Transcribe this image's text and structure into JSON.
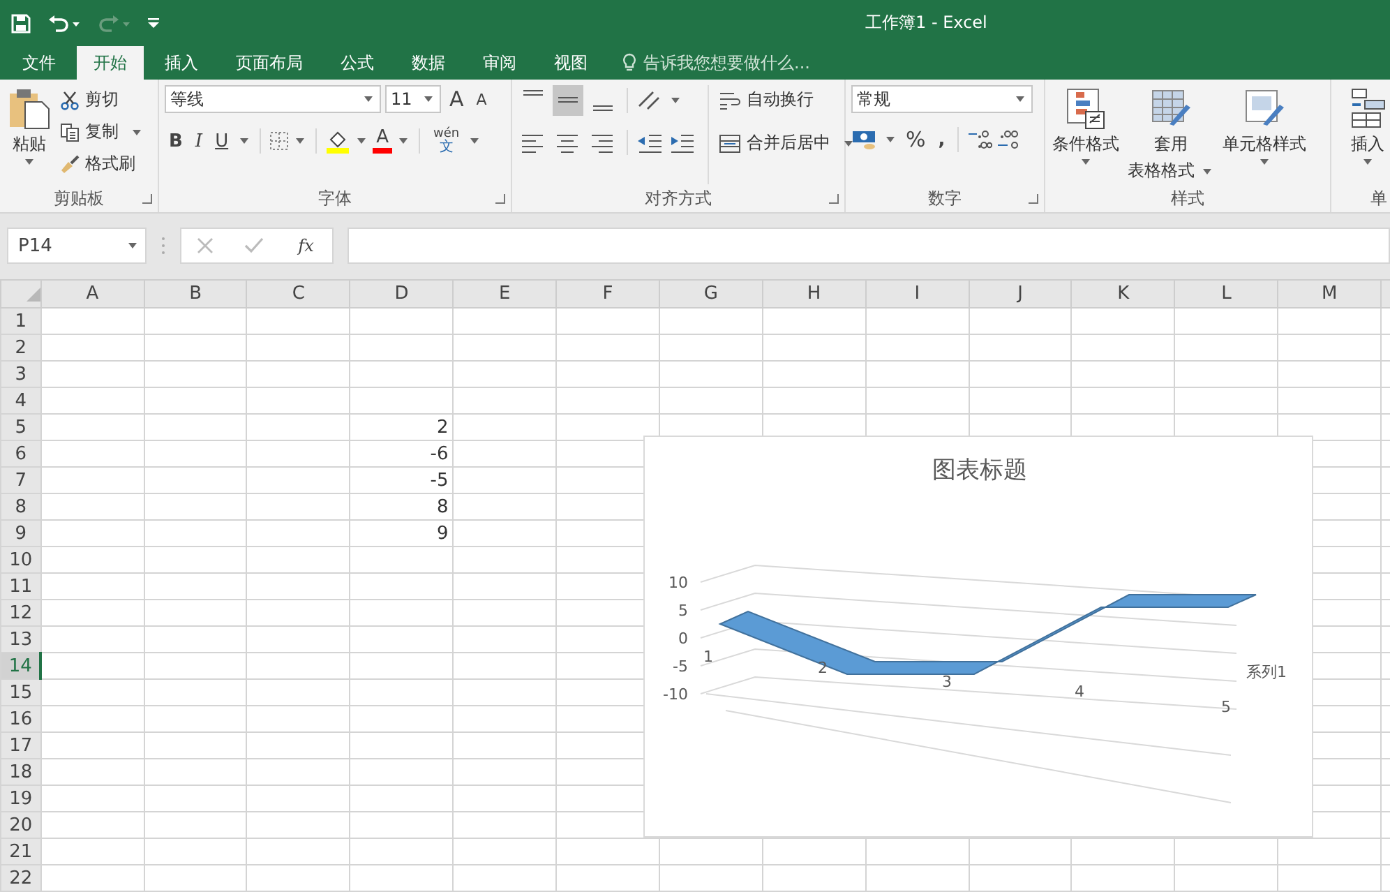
{
  "title_bar": {
    "title": "工作簿1 - Excel"
  },
  "tabs": [
    {
      "label": "文件",
      "selected": false
    },
    {
      "label": "开始",
      "selected": true
    },
    {
      "label": "插入",
      "selected": false
    },
    {
      "label": "页面布局",
      "selected": false
    },
    {
      "label": "公式",
      "selected": false
    },
    {
      "label": "数据",
      "selected": false
    },
    {
      "label": "审阅",
      "selected": false
    },
    {
      "label": "视图",
      "selected": false
    }
  ],
  "tell_me": {
    "placeholder": "告诉我您想要做什么..."
  },
  "ribbon": {
    "clipboard": {
      "label": "剪贴板",
      "paste": "粘贴",
      "cut": "剪切",
      "copy": "复制",
      "format_painter": "格式刷"
    },
    "font": {
      "label": "字体",
      "font_name": "等线",
      "font_size": "11",
      "grow": "A",
      "shrink": "A",
      "bold": "B",
      "italic": "I",
      "underline": "U",
      "font_color": "A",
      "phonetic_top": "wén",
      "phonetic_bottom": "文"
    },
    "alignment": {
      "label": "对齐方式",
      "wrap_text": "自动换行",
      "merge_center": "合并后居中"
    },
    "number": {
      "label": "数字",
      "format": "常规",
      "percent": "%",
      "comma": ","
    },
    "styles": {
      "label": "样式",
      "conditional": "条件格式",
      "table_format_line1": "套用",
      "table_format_line2": "表格格式",
      "cell_styles": "单元格样式"
    },
    "cells": {
      "label": "单",
      "insert": "插入"
    }
  },
  "formula_bar": {
    "name_box": "P14",
    "function": "fx"
  },
  "columns": [
    "A",
    "B",
    "C",
    "D",
    "E",
    "F",
    "G",
    "H",
    "I",
    "J",
    "K",
    "L",
    "M"
  ],
  "rows": [
    {
      "label": "1",
      "selected": false
    },
    {
      "label": "2",
      "selected": false
    },
    {
      "label": "3",
      "selected": false
    },
    {
      "label": "4",
      "selected": false
    },
    {
      "label": "5",
      "selected": false,
      "cells": [
        null,
        null,
        null,
        "2"
      ]
    },
    {
      "label": "6",
      "selected": false,
      "cells": [
        null,
        null,
        null,
        "-6"
      ]
    },
    {
      "label": "7",
      "selected": false,
      "cells": [
        null,
        null,
        null,
        "-5"
      ]
    },
    {
      "label": "8",
      "selected": false,
      "cells": [
        null,
        null,
        null,
        "8"
      ]
    },
    {
      "label": "9",
      "selected": false,
      "cells": [
        null,
        null,
        null,
        "9"
      ]
    },
    {
      "label": "10",
      "selected": false
    },
    {
      "label": "11",
      "selected": false
    },
    {
      "label": "12",
      "selected": false
    },
    {
      "label": "13",
      "selected": false
    },
    {
      "label": "14",
      "selected": true
    },
    {
      "label": "15",
      "selected": false
    },
    {
      "label": "16",
      "selected": false
    },
    {
      "label": "17",
      "selected": false
    },
    {
      "label": "18",
      "selected": false
    },
    {
      "label": "19",
      "selected": false
    },
    {
      "label": "20",
      "selected": false
    },
    {
      "label": "21",
      "selected": false
    },
    {
      "label": "22",
      "selected": false
    }
  ],
  "chart": {
    "title": "图表标题",
    "y_tick_labels": [
      "10",
      "5",
      "0",
      "-5",
      "-10"
    ],
    "category_labels": [
      "1",
      "2",
      "3",
      "4",
      "5"
    ],
    "series_label": "系列1"
  }
}
